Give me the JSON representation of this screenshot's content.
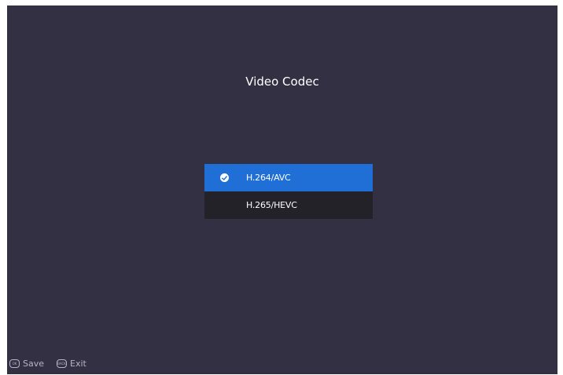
{
  "dialog": {
    "title": "Video Codec"
  },
  "options": [
    {
      "label": "H.264/AVC",
      "selected": true
    },
    {
      "label": "H.265/HEVC",
      "selected": false
    }
  ],
  "footer": {
    "save": {
      "key": "OK",
      "label": "Save"
    },
    "exit": {
      "key": "BACK",
      "label": "Exit"
    }
  },
  "colors": {
    "background": "#333043",
    "selected": "#1f6fd6",
    "list_background": "#232229",
    "text": "#ffffff",
    "hint_text": "#b7b4c4"
  }
}
